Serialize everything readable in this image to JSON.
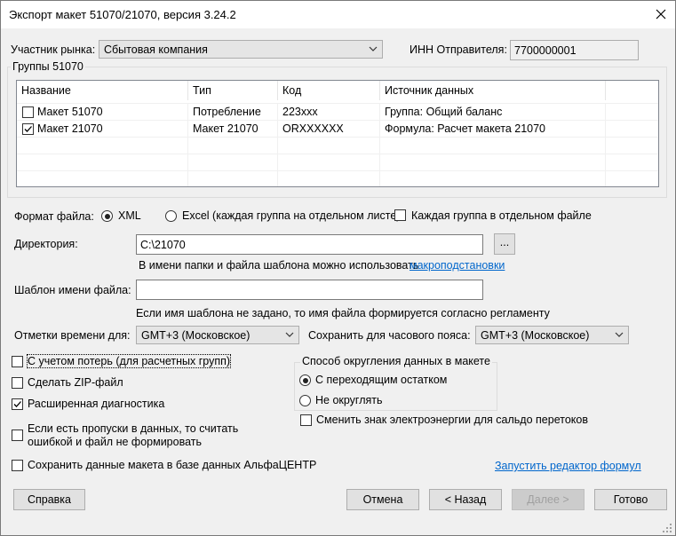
{
  "window": {
    "title": "Экспорт макет 51070/21070, версия 3.24.2"
  },
  "market": {
    "label": "Участник рынка:",
    "value": "Сбытовая компания",
    "inn_label": "ИНН Отправителя:",
    "inn_value": "7700000001"
  },
  "groups": {
    "title": "Группы 51070",
    "columns": [
      "Название",
      "Тип",
      "Код",
      "Источник данных"
    ],
    "rows": [
      {
        "name": "Макет 51070",
        "type": "Потребление",
        "code": "223xxx",
        "source": "Группа: Общий баланс",
        "checked": false
      },
      {
        "name": "Макет 21070",
        "type": "Макет 21070",
        "code": "ORXXXXXX",
        "source": "Формула: Расчет макета 21070",
        "checked": true
      }
    ]
  },
  "format": {
    "label": "Формат файла:",
    "xml": "XML",
    "excel": "Excel (каждая группа на отдельном листе)",
    "separate_file": "Каждая группа в отдельном файле",
    "selected": "XML"
  },
  "directory": {
    "label": "Директория:",
    "value": "C:\\21070",
    "browse": "...",
    "hint_prefix": "В имени папки и файла шаблона можно использовать",
    "hint_link": "макроподстановки"
  },
  "template": {
    "label": "Шаблон имени файла:",
    "value": "",
    "hint": "Если имя шаблона не задано, то имя файла формируется согласно регламенту"
  },
  "timestamps": {
    "label": "Отметки времени для:",
    "value": "GMT+3 (Московское)",
    "save_tz_label": "Сохранить для часового пояса:",
    "save_tz_value": "GMT+3 (Московское)"
  },
  "options": {
    "losses": "С учетом потерь (для расчетных групп)",
    "zip": "Сделать ZIP-файл",
    "extended_diag": "Расширенная диагностика",
    "gaps_line1": "Если есть пропуски в данных, то считать",
    "gaps_line2": "ошибкой и файл не формировать",
    "save_db": "Сохранить данные макета в базе данных АльфаЦЕНТР"
  },
  "rounding": {
    "title": "Способ округления данных в макете",
    "carry": "С переходящим остатком",
    "none": "Не округлять",
    "selected": "carry",
    "change_sign": "Сменить знак электроэнергии для сальдо перетоков"
  },
  "formula_link": "Запустить редактор формул",
  "buttons": {
    "help": "Справка",
    "cancel": "Отмена",
    "back": "< Назад",
    "next": "Далее >",
    "done": "Готово"
  }
}
